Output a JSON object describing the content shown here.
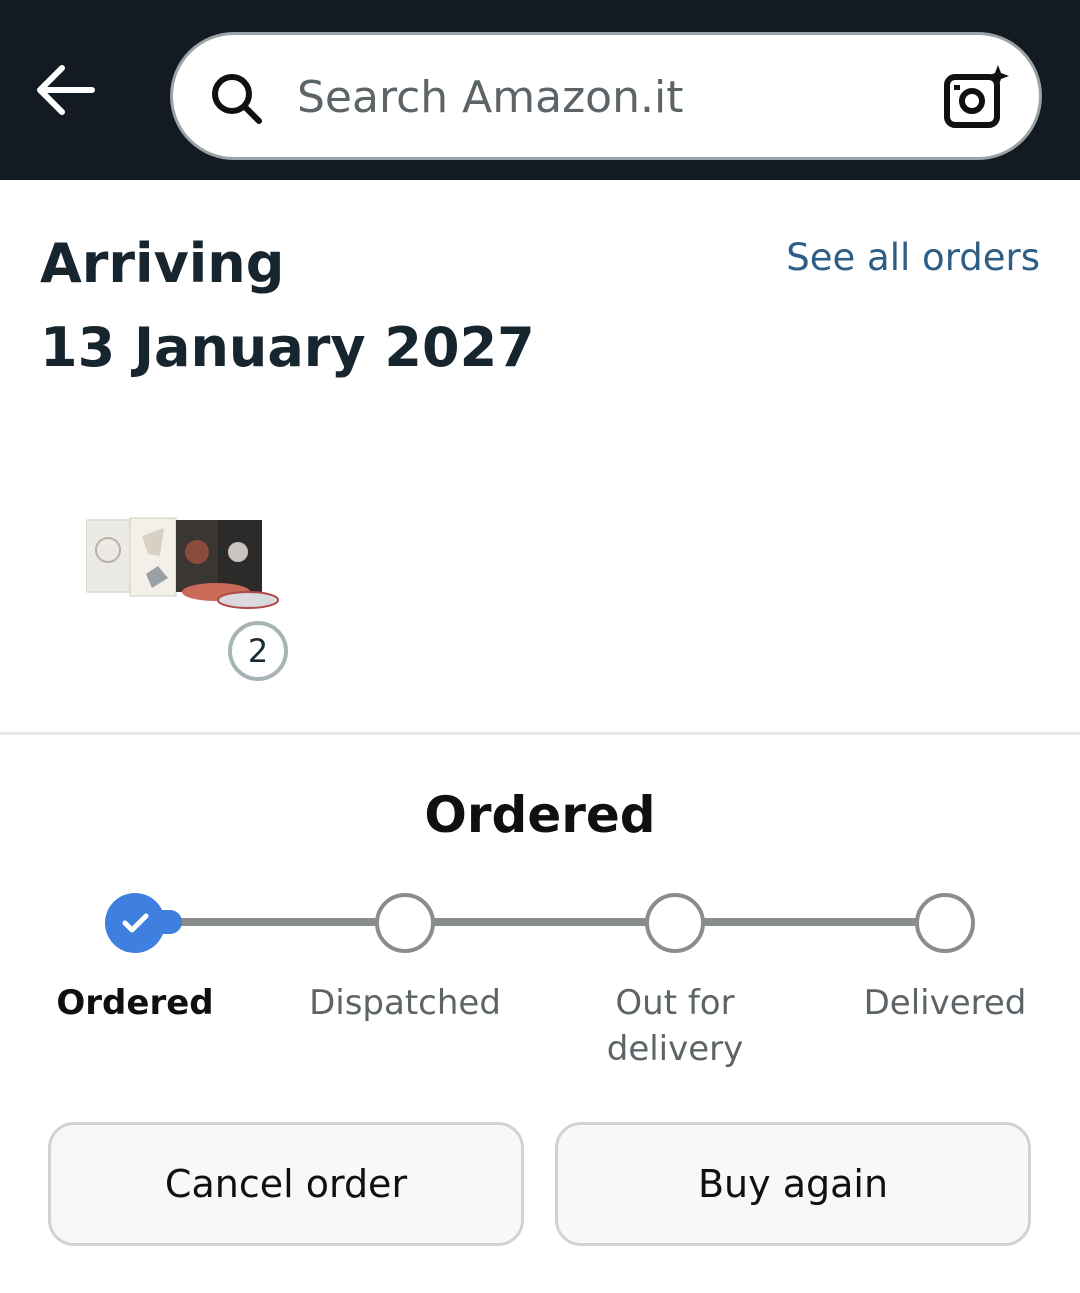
{
  "header": {
    "back_icon": "arrow-left-icon",
    "search": {
      "placeholder": "Search Amazon.it",
      "value": "",
      "icon": "search-icon",
      "camera_icon": "camera-sparkle-icon"
    }
  },
  "order": {
    "arriving_label": "Arriving",
    "arriving_date": "13 January 2027",
    "see_all_orders": "See all orders",
    "item_quantity": "2"
  },
  "status": {
    "title": "Ordered",
    "steps": [
      {
        "label": "Ordered",
        "state": "done"
      },
      {
        "label": "Dispatched",
        "state": "pending"
      },
      {
        "label": "Out for delivery",
        "state": "pending"
      },
      {
        "label": "Delivered",
        "state": "pending"
      }
    ],
    "progress_color": "#3f7fe0"
  },
  "actions": {
    "cancel_label": "Cancel order",
    "buy_again_label": "Buy again"
  },
  "colors": {
    "header_bg": "#131a22",
    "link": "#2e5d85",
    "title": "#17252f"
  }
}
